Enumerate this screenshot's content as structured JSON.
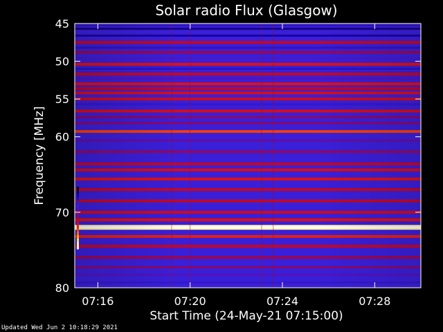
{
  "chart_data": {
    "type": "heatmap",
    "title": "Solar radio Flux (Glasgow)",
    "xlabel": "Start Time (24-May-21 07:15:00)",
    "ylabel": "Frequency [MHz]",
    "x_ticks": [
      "07:16",
      "07:20",
      "07:24",
      "07:28"
    ],
    "x_tick_minutes": [
      1,
      5,
      9,
      13
    ],
    "xlim_minutes": [
      0,
      15
    ],
    "y_ticks": [
      45,
      50,
      55,
      60,
      70,
      80
    ],
    "ylim_mhz": [
      45,
      80
    ],
    "colormap": [
      "#000000",
      "#1a00a0",
      "#3a1fd8",
      "#5a10b0",
      "#b00030",
      "#e01010",
      "#ff5a00",
      "#ffe040",
      "#ffffff"
    ],
    "bands_mhz": [
      {
        "f": 45.2,
        "level": 0.2
      },
      {
        "f": 45.7,
        "level": 0.1
      },
      {
        "f": 46.6,
        "level": 0.12
      },
      {
        "f": 47.5,
        "level": 0.55
      },
      {
        "f": 48.2,
        "level": 0.2
      },
      {
        "f": 48.8,
        "level": 0.5
      },
      {
        "f": 49.6,
        "level": 0.3
      },
      {
        "f": 50.4,
        "level": 0.62
      },
      {
        "f": 51.0,
        "level": 0.2
      },
      {
        "f": 51.7,
        "level": 0.55
      },
      {
        "f": 52.3,
        "level": 0.35
      },
      {
        "f": 53.0,
        "level": 0.62
      },
      {
        "f": 53.6,
        "level": 0.55
      },
      {
        "f": 54.2,
        "level": 0.6
      },
      {
        "f": 55.0,
        "level": 0.58
      },
      {
        "f": 55.7,
        "level": 0.22
      },
      {
        "f": 56.6,
        "level": 0.6
      },
      {
        "f": 57.4,
        "level": 0.45
      },
      {
        "f": 58.2,
        "level": 0.45
      },
      {
        "f": 59.3,
        "level": 0.7
      },
      {
        "f": 60.5,
        "level": 0.4
      },
      {
        "f": 62.0,
        "level": 0.48
      },
      {
        "f": 63.6,
        "level": 0.55
      },
      {
        "f": 64.4,
        "level": 0.6
      },
      {
        "f": 65.6,
        "level": 0.62
      },
      {
        "f": 67.0,
        "level": 0.55
      },
      {
        "f": 68.5,
        "level": 0.55
      },
      {
        "f": 70.0,
        "level": 0.58
      },
      {
        "f": 71.0,
        "level": 0.62
      },
      {
        "f": 72.0,
        "level": 0.95
      },
      {
        "f": 73.2,
        "level": 0.65
      },
      {
        "f": 74.5,
        "level": 0.55
      },
      {
        "f": 76.0,
        "level": 0.5
      },
      {
        "f": 77.3,
        "level": 0.45
      },
      {
        "f": 78.3,
        "level": 0.35
      },
      {
        "f": 79.3,
        "level": 0.22
      }
    ],
    "colorbar_levels": [
      0.0,
      0.25,
      0.45,
      0.65,
      0.85,
      1.0
    ]
  },
  "footer": {
    "updated_text": "Updated Wed Jun  2 10:18:29 2021"
  }
}
